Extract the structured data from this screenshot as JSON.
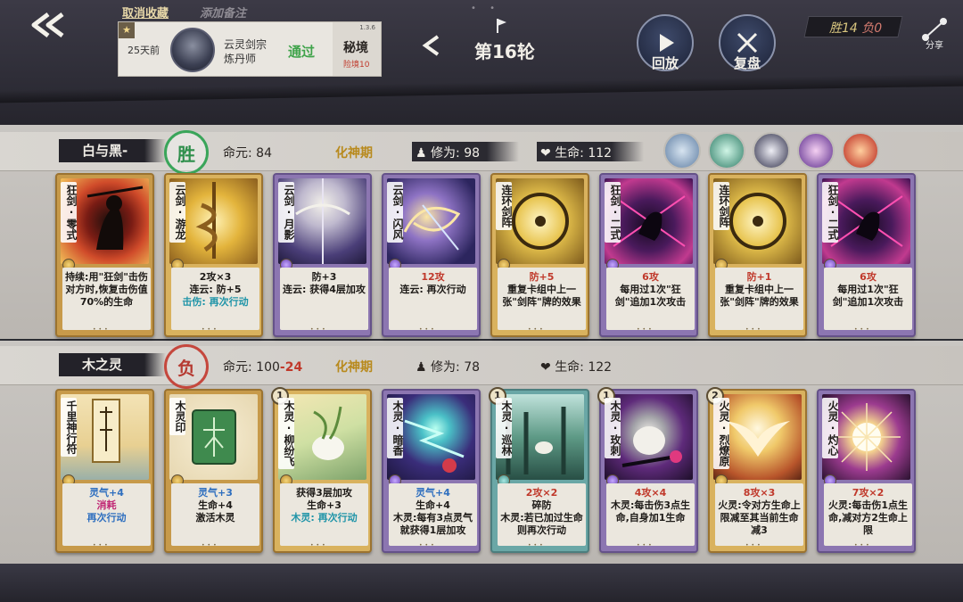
{
  "top": {
    "fav_label": "取消收藏",
    "note_label": "添加备注",
    "record": {
      "time": "25天前",
      "sect": "云灵剑宗",
      "class": "炼丹师",
      "result": "通过",
      "version": "1.3.6",
      "mode": "秘境",
      "level": "险境10"
    },
    "round_label": "第16轮",
    "replay_label": "回放",
    "review_label": "复盘",
    "score_win": "胜14",
    "score_lose": "负0",
    "share_label": "分享"
  },
  "player1": {
    "name": "白与黑-",
    "result": "胜",
    "life_label": "命元:",
    "life_value": "84",
    "realm": "化神期",
    "cultivation_label": "修为:",
    "cultivation_value": "98",
    "hp_label": "生命:",
    "hp_value": "112",
    "cards": [
      {
        "name": "狂剑·零式",
        "desc": [
          "持续:用\"狂剑\"击伤对方时,恢复击伤值70%的生命"
        ]
      },
      {
        "name": "云剑·游龙",
        "desc": [
          "2攻×3",
          "连云: 防+5",
          "击伤: 再次行动"
        ]
      },
      {
        "name": "云剑·月影",
        "desc": [
          "防+3",
          "连云: 获得4层加攻"
        ]
      },
      {
        "name": "云剑·闪风",
        "desc": [
          "12攻",
          "连云: 再次行动"
        ]
      },
      {
        "name": "连环剑阵",
        "desc": [
          "防+5",
          "重复卡组中上一张\"剑阵\"牌的效果"
        ]
      },
      {
        "name": "狂剑·二式",
        "desc": [
          "6攻",
          "每用过1次\"狂剑\"追加1次攻击"
        ]
      },
      {
        "name": "连环剑阵",
        "desc": [
          "防+1",
          "重复卡组中上一张\"剑阵\"牌的效果"
        ]
      },
      {
        "name": "狂剑·二式",
        "desc": [
          "6攻",
          "每用过1次\"狂剑\"追加1次攻击"
        ]
      }
    ]
  },
  "player2": {
    "name": "木之灵",
    "result": "负",
    "life_label": "命元:",
    "life_value": "100",
    "life_delta": "-24",
    "realm": "化神期",
    "cultivation_label": "修为:",
    "cultivation_value": "78",
    "hp_label": "生命:",
    "hp_value": "122",
    "cards": [
      {
        "name": "千里神行符",
        "level": "",
        "desc": [
          "灵气+4",
          "消耗",
          "再次行动"
        ]
      },
      {
        "name": "木灵印",
        "level": "",
        "desc": [
          "灵气+3",
          "生命+4",
          "激活木灵"
        ]
      },
      {
        "name": "木灵·柳纷飞",
        "level": "1",
        "desc": [
          "获得3层加攻",
          "生命+3",
          "木灵: 再次行动"
        ]
      },
      {
        "name": "木灵·暗香",
        "level": "",
        "desc": [
          "灵气+4",
          "生命+4",
          "木灵:每有3点灵气就获得1层加攻"
        ]
      },
      {
        "name": "木灵·巡林",
        "level": "1",
        "desc": [
          "2攻×2",
          "碎防",
          "木灵:若已加过生命则再次行动"
        ]
      },
      {
        "name": "木灵·玫刺",
        "level": "1",
        "desc": [
          "4攻×4",
          "木灵:每击伤3点生命,自身加1生命"
        ]
      },
      {
        "name": "火灵·烈燎原",
        "level": "2",
        "desc": [
          "8攻×3",
          "火灵:令对方生命上限减至其当前生命减3"
        ]
      },
      {
        "name": "火灵·灼心",
        "level": "",
        "desc": [
          "7攻×2",
          "火灵:每击伤1点生命,减对方2生命上限"
        ]
      }
    ]
  },
  "colors": {
    "win": "#3aa55a",
    "lose": "#c5473d",
    "realm": "#b88a1d",
    "keyword_red": "#c0392b",
    "keyword_cyan": "#1f94a8"
  }
}
